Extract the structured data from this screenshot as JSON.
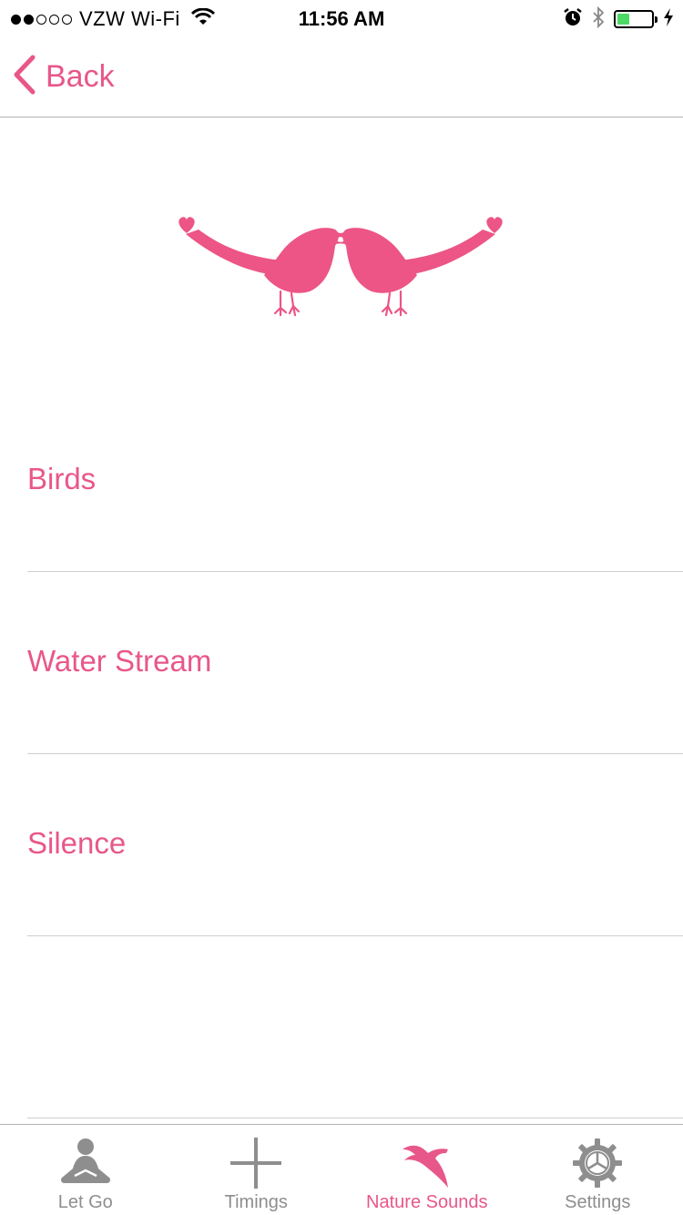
{
  "status_bar": {
    "carrier": "VZW Wi-Fi",
    "time": "11:56 AM",
    "battery_level": 0.35,
    "battery_color": "#4cd964"
  },
  "nav": {
    "back_label": "Back",
    "accent_color": "#e8578a"
  },
  "hero": {
    "icon": "love-birds-icon"
  },
  "list": {
    "items": [
      {
        "label": "Birds"
      },
      {
        "label": "Water Stream"
      },
      {
        "label": "Silence"
      }
    ]
  },
  "tab_bar": {
    "tabs": [
      {
        "label": "Let Go",
        "icon": "meditation-icon",
        "active": false
      },
      {
        "label": "Timings",
        "icon": "plus-icon",
        "active": false
      },
      {
        "label": "Nature Sounds",
        "icon": "bird-icon",
        "active": true
      },
      {
        "label": "Settings",
        "icon": "gear-icon",
        "active": false
      }
    ],
    "inactive_color": "#8e8e8e",
    "active_color": "#e8578a"
  }
}
